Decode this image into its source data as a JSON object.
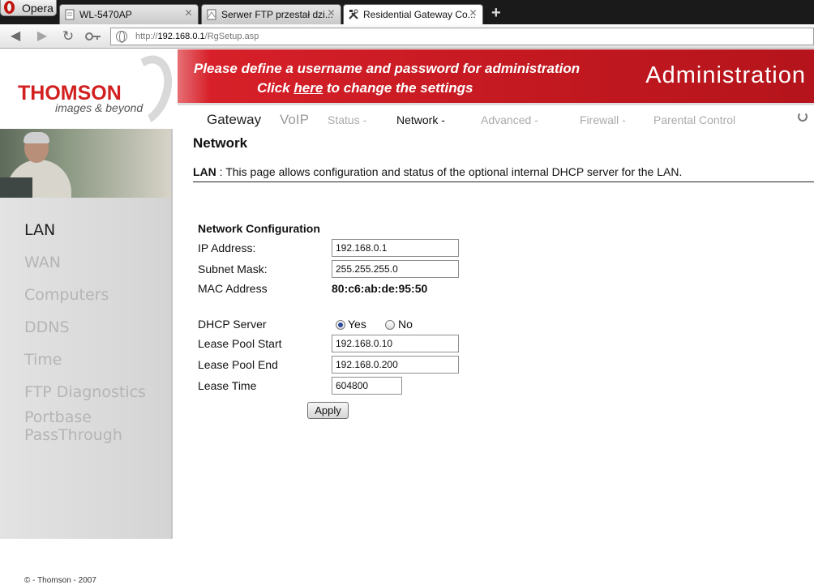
{
  "browser": {
    "menu_label": "Opera",
    "tabs": [
      {
        "title": "WL-5470AP"
      },
      {
        "title": "Serwer FTP przestał dzi..."
      },
      {
        "title": "Residential Gateway Co..."
      }
    ],
    "url_prefix": "http://",
    "url_host": "192.168.0.1",
    "url_path": "/RgSetup.asp"
  },
  "header": {
    "logo_brand": "THOMSON",
    "logo_tagline": "images & beyond",
    "banner_line1": "Please define a username and password for administration",
    "banner_line2_prefix": "Click ",
    "banner_line2_link": "here",
    "banner_line2_suffix": " to change the settings",
    "banner_title": "Administration"
  },
  "topnav": {
    "items": [
      {
        "label": "Gateway"
      },
      {
        "label": "VoIP"
      },
      {
        "label": "Status -"
      },
      {
        "label": "Network -"
      },
      {
        "label": "Advanced -"
      },
      {
        "label": "Firewall -"
      },
      {
        "label": "Parental Control"
      }
    ]
  },
  "sidebar": {
    "items": [
      {
        "label": "LAN"
      },
      {
        "label": "WAN"
      },
      {
        "label": "Computers"
      },
      {
        "label": "DDNS"
      },
      {
        "label": "Time"
      },
      {
        "label": "FTP Diagnostics"
      },
      {
        "label": "Portbase"
      },
      {
        "label": "PassThrough"
      }
    ],
    "copyright": "© - Thomson - 2007"
  },
  "main": {
    "title": "Network",
    "desc_label": "LAN",
    "desc_sep": " : ",
    "desc_text": "This page allows configuration and status of the optional internal DHCP server for the LAN.",
    "section_title": "Network Configuration",
    "fields": {
      "ip_label": "IP Address:",
      "ip_value": "192.168.0.1",
      "subnet_label": "Subnet Mask:",
      "subnet_value": "255.255.255.0",
      "mac_label": "MAC Address",
      "mac_value": "80:c6:ab:de:95:50",
      "dhcp_label": "DHCP Server",
      "dhcp_yes": "Yes",
      "dhcp_no": "No",
      "pool_start_label": "Lease Pool Start",
      "pool_start_value": "192.168.0.10",
      "pool_end_label": "Lease Pool End",
      "pool_end_value": "192.168.0.200",
      "lease_time_label": "Lease Time",
      "lease_time_value": "604800"
    },
    "apply_label": "Apply"
  },
  "colors": {
    "brand_red": "#d21f1f",
    "banner_red": "#c21820"
  }
}
